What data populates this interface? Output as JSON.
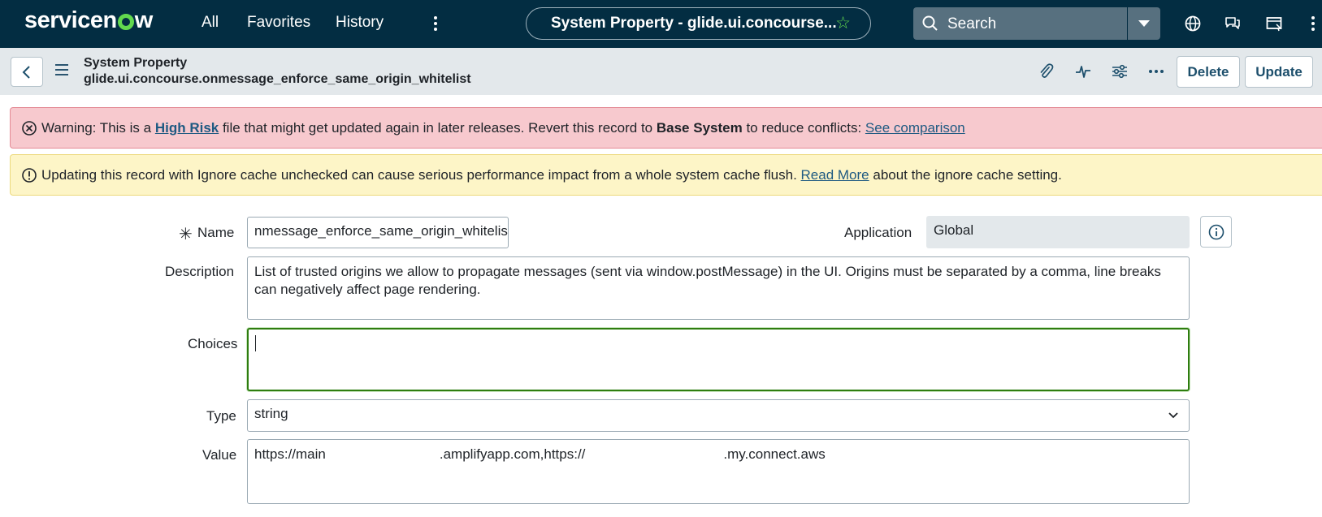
{
  "topnav": {
    "logo_prefix": "servicen",
    "logo_suffix": "w",
    "all": "All",
    "favorites": "Favorites",
    "history": "History",
    "context_title": "System Property - glide.ui.concourse...",
    "search_placeholder": "Search",
    "icons": [
      "globe-icon",
      "chat-icon",
      "screen-icon"
    ]
  },
  "formheader": {
    "record_type": "System Property",
    "record_name": "glide.ui.concourse.onmessage_enforce_same_origin_whitelist",
    "delete_label": "Delete",
    "update_label": "Update"
  },
  "banners": {
    "error": {
      "prefix": "Warning: This is a ",
      "link1": "High Risk",
      "middle": " file that might get updated again in later releases. Revert this record to ",
      "bold": "Base System",
      "tail": " to reduce conflicts: ",
      "link2": "See comparison"
    },
    "warning": {
      "prefix": "Updating this record with Ignore cache unchecked can cause serious performance impact from a whole system cache flush. ",
      "link": "Read More",
      "tail": " about the ignore cache setting."
    }
  },
  "form": {
    "name_label": "Name",
    "name_value": "nmessage_enforce_same_origin_whitelist",
    "application_label": "Application",
    "application_value": "Global",
    "description_label": "Description",
    "description_value": "List of trusted origins we allow to propagate messages (sent via window.postMessage) in the UI. Origins must be separated by a comma, line breaks can negatively affect page rendering.",
    "choices_label": "Choices",
    "choices_value": "",
    "type_label": "Type",
    "type_value": "string",
    "value_label": "Value",
    "value_part1": "https://main",
    "value_part2": ".amplifyapp.com,https://",
    "value_part3": ".my.connect.aws"
  },
  "colors": {
    "nav_bg": "#032d42",
    "accent_green": "#62d84e",
    "error_bg": "#f7c9ce",
    "warn_bg": "#fdf5c7",
    "focus_border": "#2e7d0f"
  }
}
